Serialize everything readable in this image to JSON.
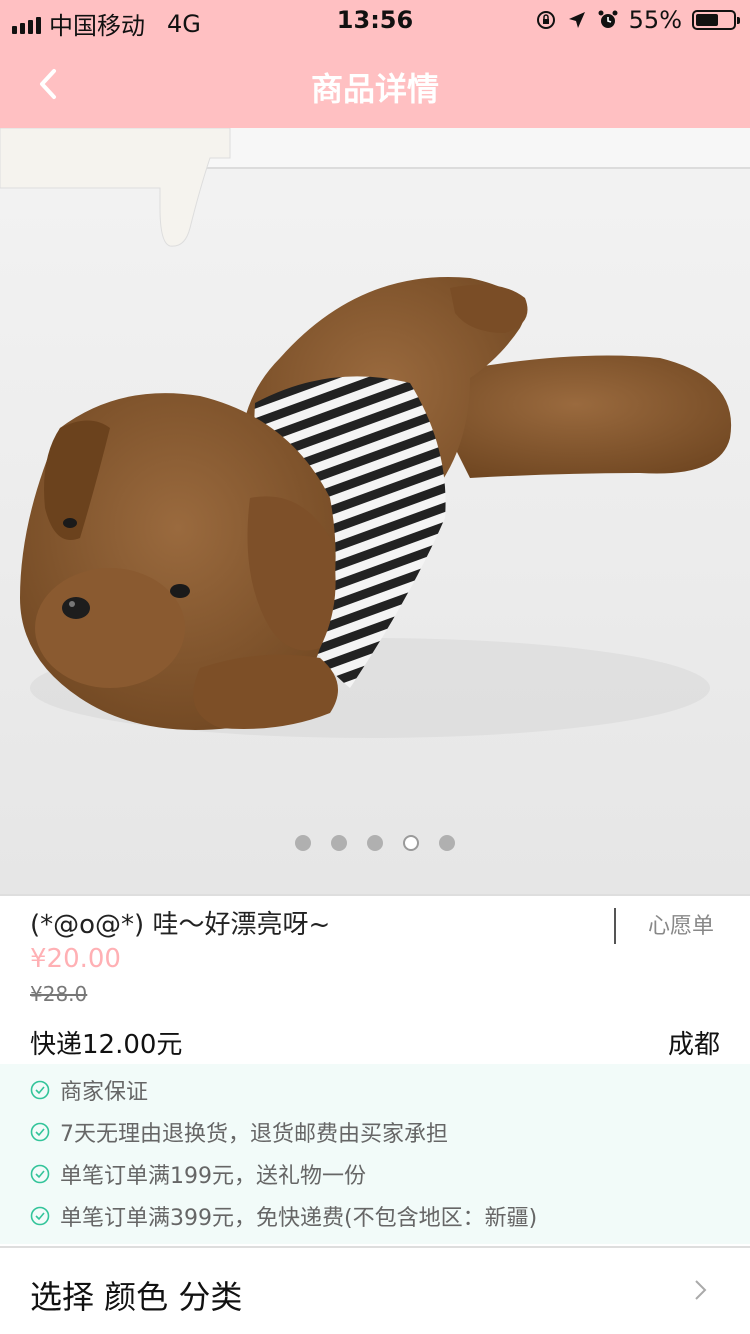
{
  "status_bar": {
    "carrier": "中国移动",
    "network": "4G",
    "time": "13:56",
    "battery": "55%",
    "battery_level": 0.55,
    "icons": [
      "signal-icon",
      "orientation-lock-icon",
      "location-icon",
      "alarm-icon",
      "battery-icon"
    ]
  },
  "nav": {
    "back_icon": "chevron-left-icon",
    "title": "商品详情"
  },
  "gallery": {
    "image": "brown plush puppy toy wearing striped shirt",
    "dot_count": 5,
    "active_index": 3
  },
  "product": {
    "title": "(*@o@*) 哇～好漂亮呀~",
    "wishlist": "心愿单",
    "price": "¥20.00",
    "original_price": "¥28.0",
    "shipping": "快递12.00元",
    "location": "成都"
  },
  "guarantees": [
    "商家保证",
    "7天无理由退换货，退货邮费由买家承担",
    "单笔订单满199元，送礼物一份",
    "单笔订单满399元，免快递费(不包含地区：新疆)"
  ],
  "options": {
    "label": "选择 颜色 分类",
    "icon": "chevron-right-icon"
  },
  "colors": {
    "header_bg": "#ffc0c2",
    "price": "#ffb0b4",
    "check_icon": "#33c49a",
    "guarantee_bg": "#f2fbf9"
  }
}
